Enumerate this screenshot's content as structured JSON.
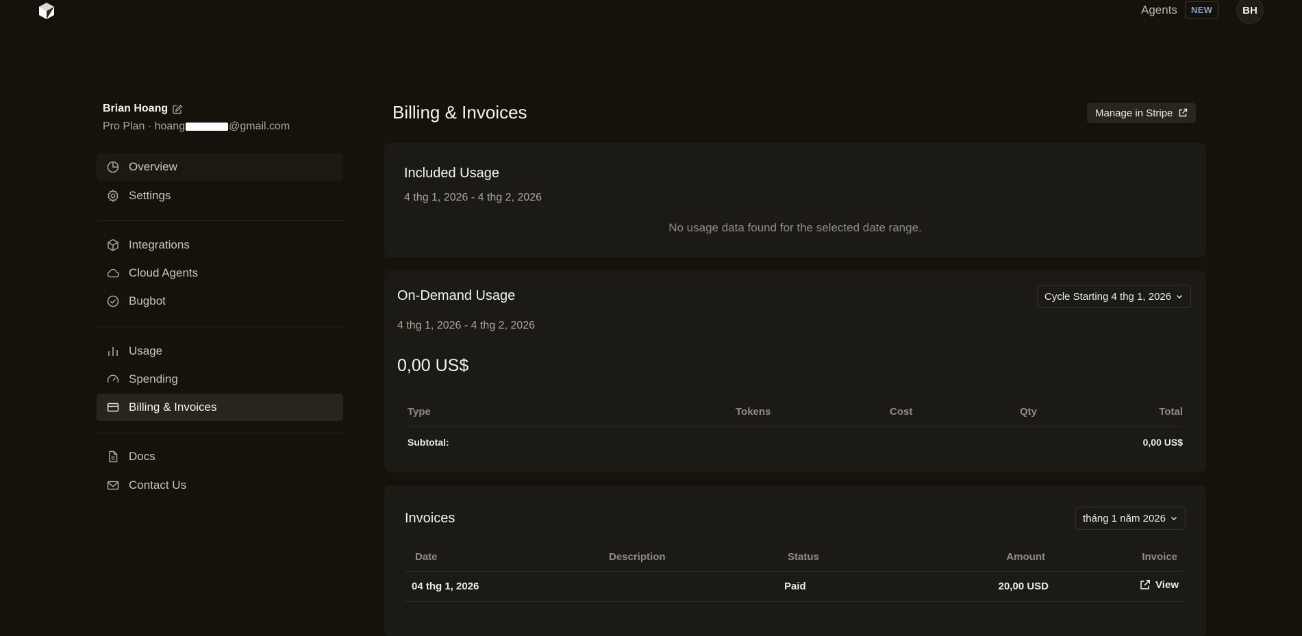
{
  "topbar": {
    "agents_label": "Agents",
    "new_badge": "NEW",
    "avatar_initials": "BH"
  },
  "user": {
    "name": "Brian Hoang",
    "plan": "Pro Plan",
    "separator": "·",
    "email_prefix": "hoang",
    "email_suffix": "@gmail.com"
  },
  "sidebar": {
    "items": [
      {
        "label": "Overview",
        "icon": "pie-chart-icon"
      },
      {
        "label": "Settings",
        "icon": "gear-icon"
      },
      {
        "label": "Integrations",
        "icon": "cube-icon"
      },
      {
        "label": "Cloud Agents",
        "icon": "cloud-icon"
      },
      {
        "label": "Bugbot",
        "icon": "check-circle-icon"
      },
      {
        "label": "Usage",
        "icon": "bar-chart-icon"
      },
      {
        "label": "Spending",
        "icon": "gauge-icon"
      },
      {
        "label": "Billing & Invoices",
        "icon": "credit-card-icon"
      },
      {
        "label": "Docs",
        "icon": "document-icon"
      },
      {
        "label": "Contact Us",
        "icon": "mail-icon"
      }
    ]
  },
  "main": {
    "title": "Billing & Invoices",
    "manage_stripe_label": "Manage in Stripe",
    "included": {
      "title": "Included Usage",
      "date_range": "4 thg 1, 2026 - 4 thg 2, 2026",
      "empty_message": "No usage data found for the selected date range."
    },
    "ondemand": {
      "title": "On-Demand Usage",
      "cycle_label": "Cycle Starting 4 thg 1, 2026",
      "date_range": "4 thg 1, 2026 - 4 thg 2, 2026",
      "amount": "0,00 US$",
      "columns": [
        "Type",
        "Tokens",
        "Cost",
        "Qty",
        "Total"
      ],
      "subtotal_label": "Subtotal:",
      "subtotal_value": "0,00 US$"
    },
    "invoices": {
      "title": "Invoices",
      "month_label": "tháng 1 năm 2026",
      "columns": [
        "Date",
        "Description",
        "Status",
        "Amount",
        "Invoice"
      ],
      "rows": [
        {
          "date": "04 thg 1, 2026",
          "description": "",
          "status": "Paid",
          "amount": "20,00 USD",
          "invoice": "View"
        }
      ]
    }
  }
}
